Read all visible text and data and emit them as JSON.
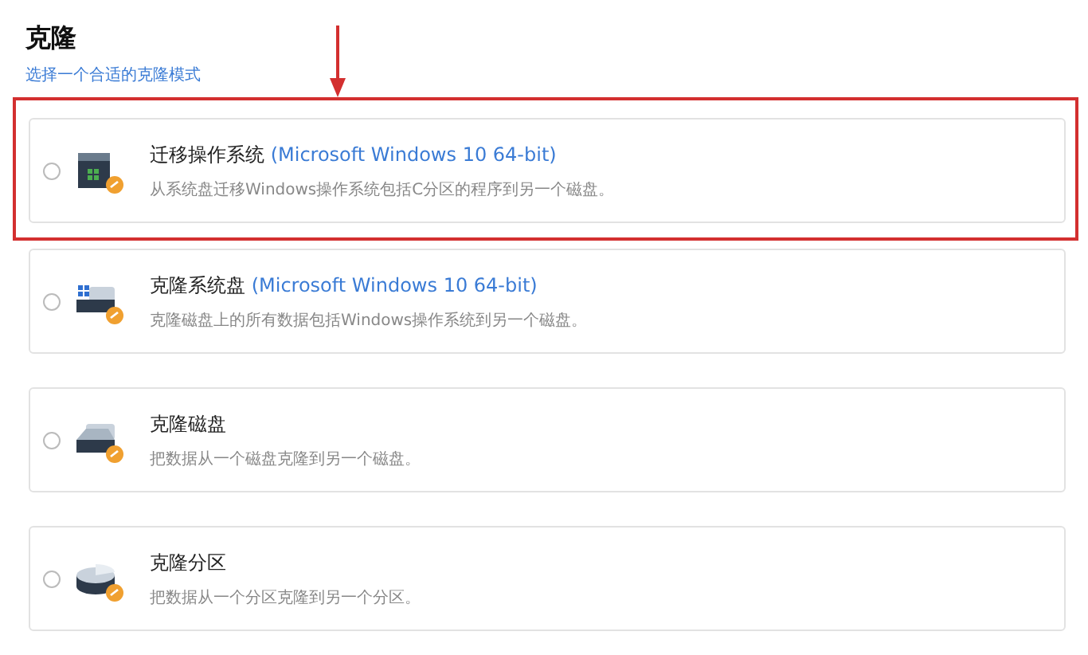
{
  "title": "克隆",
  "subtitle": "选择一个合适的克隆模式",
  "options": [
    {
      "kind": "os",
      "title": "迁移操作系统",
      "detail": "(Microsoft Windows 10 64-bit)",
      "description": "从系统盘迁移Windows操作系统包括C分区的程序到另一个磁盘。",
      "selected": false,
      "highlighted": true
    },
    {
      "kind": "system-disk",
      "title": "克隆系统盘",
      "detail": "(Microsoft Windows 10 64-bit)",
      "description": "克隆磁盘上的所有数据包括Windows操作系统到另一个磁盘。",
      "selected": false,
      "highlighted": false
    },
    {
      "kind": "disk",
      "title": "克隆磁盘",
      "description": "把数据从一个磁盘克隆到另一个磁盘。",
      "selected": false,
      "highlighted": false
    },
    {
      "kind": "partition",
      "title": "克隆分区",
      "description": "把数据从一个分区克隆到另一个分区。",
      "selected": false,
      "highlighted": false
    }
  ]
}
